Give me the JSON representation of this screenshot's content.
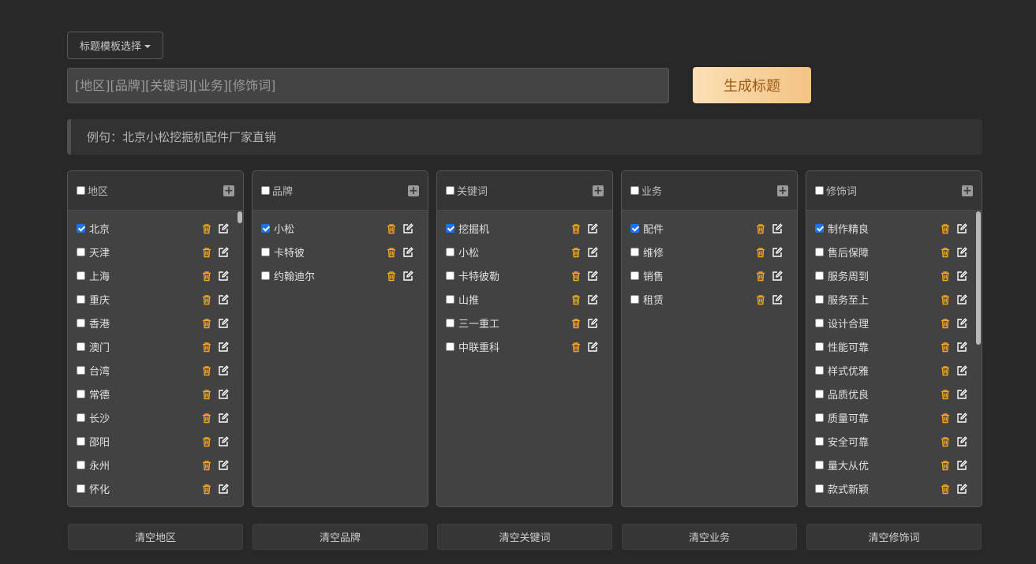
{
  "template_dropdown": {
    "label": "标题模板选择"
  },
  "title_input": {
    "placeholder": "[地区][品牌][关键词][业务][修饰词]"
  },
  "generate_button": {
    "label": "生成标题"
  },
  "example": {
    "text": "例句：北京小松挖掘机配件厂家直销"
  },
  "colors": {
    "accent": "#f3c384",
    "accent_text": "#9b5a17",
    "icon": "#f5a623",
    "checkbox": "#1a73e8"
  },
  "panels": [
    {
      "id": "region",
      "label": "地区",
      "header_checked": false,
      "items": [
        {
          "label": "北京",
          "checked": true
        },
        {
          "label": "天津",
          "checked": false
        },
        {
          "label": "上海",
          "checked": false
        },
        {
          "label": "重庆",
          "checked": false
        },
        {
          "label": "香港",
          "checked": false
        },
        {
          "label": "澳门",
          "checked": false
        },
        {
          "label": "台湾",
          "checked": false
        },
        {
          "label": "常德",
          "checked": false
        },
        {
          "label": "长沙",
          "checked": false
        },
        {
          "label": "邵阳",
          "checked": false
        },
        {
          "label": "永州",
          "checked": false
        },
        {
          "label": "怀化",
          "checked": false
        }
      ],
      "scroll": {
        "position": 0.0,
        "visible_fraction": 0.04
      },
      "clear_label": "清空地区"
    },
    {
      "id": "brand",
      "label": "品牌",
      "header_checked": false,
      "items": [
        {
          "label": "小松",
          "checked": true
        },
        {
          "label": "卡特彼",
          "checked": false
        },
        {
          "label": "约翰迪尔",
          "checked": false
        }
      ],
      "scroll": null,
      "clear_label": "清空品牌"
    },
    {
      "id": "keyword",
      "label": "关键词",
      "header_checked": false,
      "items": [
        {
          "label": "挖掘机",
          "checked": true
        },
        {
          "label": "小松",
          "checked": false
        },
        {
          "label": "卡特彼勒",
          "checked": false
        },
        {
          "label": "山推",
          "checked": false
        },
        {
          "label": "三一重工",
          "checked": false
        },
        {
          "label": "中联重科",
          "checked": false
        }
      ],
      "scroll": null,
      "clear_label": "清空关键词"
    },
    {
      "id": "business",
      "label": "业务",
      "header_checked": false,
      "items": [
        {
          "label": "配件",
          "checked": true
        },
        {
          "label": "维修",
          "checked": false
        },
        {
          "label": "销售",
          "checked": false
        },
        {
          "label": "租赁",
          "checked": false
        }
      ],
      "scroll": null,
      "clear_label": "清空业务"
    },
    {
      "id": "modifier",
      "label": "修饰词",
      "header_checked": false,
      "items": [
        {
          "label": "制作精良",
          "checked": true
        },
        {
          "label": "售后保障",
          "checked": false
        },
        {
          "label": "服务周到",
          "checked": false
        },
        {
          "label": "服务至上",
          "checked": false
        },
        {
          "label": "设计合理",
          "checked": false
        },
        {
          "label": "性能可靠",
          "checked": false
        },
        {
          "label": "样式优雅",
          "checked": false
        },
        {
          "label": "品质优良",
          "checked": false
        },
        {
          "label": "质量可靠",
          "checked": false
        },
        {
          "label": "安全可靠",
          "checked": false
        },
        {
          "label": "量大从优",
          "checked": false
        },
        {
          "label": "款式新颖",
          "checked": false
        }
      ],
      "scroll": {
        "position": 0.0,
        "visible_fraction": 0.45
      },
      "clear_label": "清空修饰词"
    }
  ]
}
